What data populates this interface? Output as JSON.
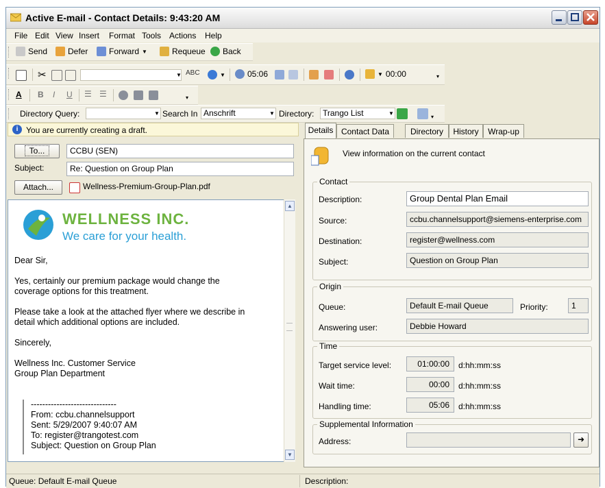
{
  "window": {
    "title": "Active E-mail - Contact Details: 9:43:20 AM"
  },
  "menu": [
    "File",
    "Edit",
    "View",
    "Insert",
    "Format",
    "Tools",
    "Actions",
    "Help"
  ],
  "toolbar1": {
    "send": "Send",
    "defer": "Defer",
    "forward": "Forward",
    "requeue": "Requeue",
    "back": "Back"
  },
  "toolbar2": {
    "timer": "05:06",
    "clock": "00:00"
  },
  "query": {
    "dir_query_label": "Directory Query:",
    "search_in_label": "Search In",
    "search_in_value": "Anschrift",
    "directory_label": "Directory:",
    "directory_value": "Trango List"
  },
  "draft": {
    "notice": "You are currently creating a draft."
  },
  "compose": {
    "to_button": "To...",
    "to_value": "CCBU (SEN)",
    "subject_label": "Subject:",
    "subject_value": "Re: Question on Group Plan",
    "attach_button": "Attach...",
    "attachment": "Wellness-Premium-Group-Plan.pdf"
  },
  "email_body": {
    "logo_name": "WELLNESS INC.",
    "logo_tagline": "We care for your health.",
    "greeting": "Dear Sir,",
    "para1_l1": "Yes, certainly our premium package would change the",
    "para1_l2": "coverage options for this treatment.",
    "para2_l1": "Please take a look at the attached flyer where we describe in",
    "para2_l2": "detail which additional options are included.",
    "closing": "Sincerely,",
    "sig1": "Wellness Inc. Customer Service",
    "sig2": "Group Plan Department",
    "quote_sep": "------------------------------",
    "quote_from": "From: ccbu.channelsupport",
    "quote_sent": "Sent: 5/29/2007 9:40:07 AM",
    "quote_to": "To: register@trangotest.com",
    "quote_subject": "Subject: Question on Group Plan"
  },
  "tabs": [
    "Details",
    "Contact Data",
    "Directory",
    "History",
    "Wrap-up"
  ],
  "details": {
    "header": "View information on the current contact",
    "contact": {
      "title": "Contact",
      "description_label": "Description:",
      "description_value": "Group Dental Plan Email",
      "source_label": "Source:",
      "source_value": "ccbu.channelsupport@siemens-enterprise.com",
      "destination_label": "Destination:",
      "destination_value": "register@wellness.com",
      "subject_label": "Subject:",
      "subject_value": "Question on Group Plan"
    },
    "origin": {
      "title": "Origin",
      "queue_label": "Queue:",
      "queue_value": "Default E-mail Queue",
      "priority_label": "Priority:",
      "priority_value": "1",
      "user_label": "Answering user:",
      "user_value": "Debbie Howard"
    },
    "time": {
      "title": "Time",
      "tsl_label": "Target service level:",
      "tsl_value": "01:00:00",
      "wait_label": "Wait time:",
      "wait_value": "00:00",
      "handling_label": "Handling time:",
      "handling_value": "05:06",
      "unit": "d:hh:mm:ss"
    },
    "supplemental": {
      "title": "Supplemental Information",
      "address_label": "Address:",
      "address_value": ""
    }
  },
  "status": {
    "left": "Queue: Default E-mail Queue",
    "right": "Description:"
  },
  "colors": {
    "accent": "#2d63c7",
    "logo_green": "#6db33f",
    "logo_blue": "#2a9fd6"
  }
}
